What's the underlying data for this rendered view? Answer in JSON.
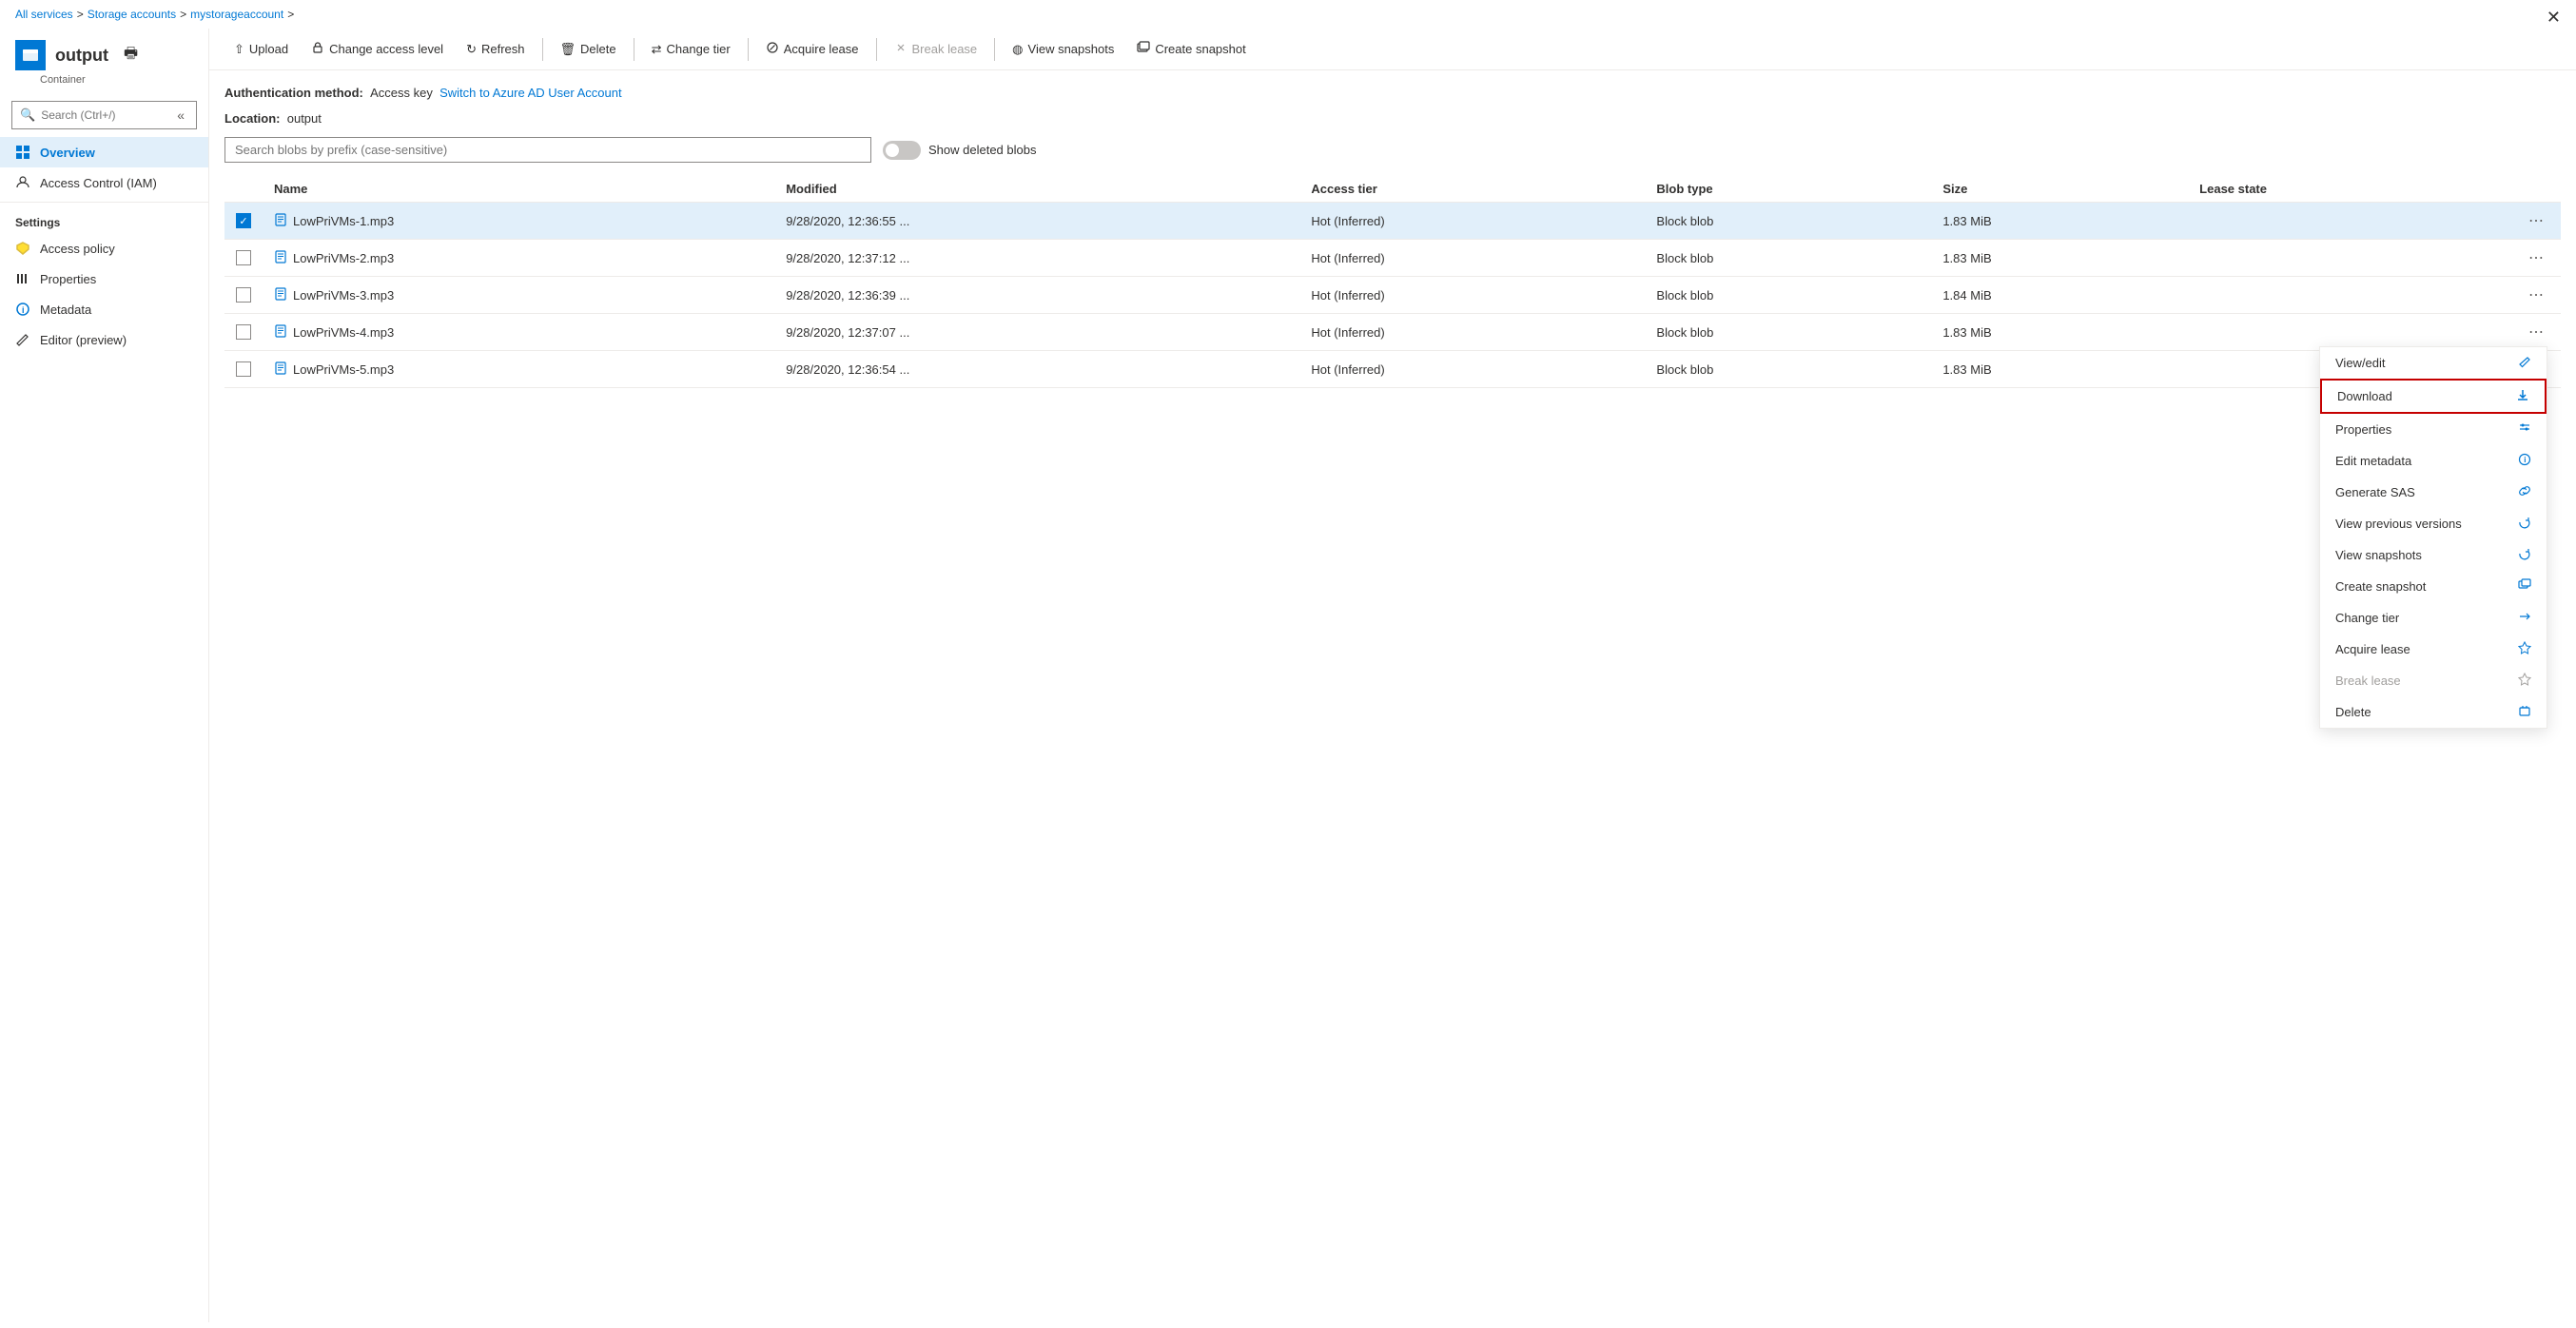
{
  "breadcrumb": {
    "all_services": "All services",
    "storage_accounts": "Storage accounts",
    "storage_account_name": "mystorageaccount"
  },
  "sidebar": {
    "container_name": "output",
    "container_type": "Container",
    "search_placeholder": "Search (Ctrl+/)",
    "nav_items": [
      {
        "id": "overview",
        "label": "Overview",
        "active": true
      },
      {
        "id": "access-control",
        "label": "Access Control (IAM)",
        "active": false
      }
    ],
    "settings_label": "Settings",
    "settings_items": [
      {
        "id": "access-policy",
        "label": "Access policy"
      },
      {
        "id": "properties",
        "label": "Properties"
      },
      {
        "id": "metadata",
        "label": "Metadata"
      },
      {
        "id": "editor",
        "label": "Editor (preview)"
      }
    ]
  },
  "toolbar": {
    "upload_label": "Upload",
    "change_access_label": "Change access level",
    "refresh_label": "Refresh",
    "delete_label": "Delete",
    "change_tier_label": "Change tier",
    "acquire_lease_label": "Acquire lease",
    "break_lease_label": "Break lease",
    "view_snapshots_label": "View snapshots",
    "create_snapshot_label": "Create snapshot"
  },
  "auth": {
    "method_label": "Authentication method:",
    "method_value": "Access key",
    "switch_link": "Switch to Azure AD User Account",
    "location_label": "Location:",
    "location_value": "output"
  },
  "blob_search": {
    "placeholder": "Search blobs by prefix (case-sensitive)",
    "show_deleted_label": "Show deleted blobs"
  },
  "table": {
    "columns": [
      "Name",
      "Modified",
      "Access tier",
      "Blob type",
      "Size",
      "Lease state"
    ],
    "rows": [
      {
        "name": "LowPriVMs-1.mp3",
        "modified": "9/28/2020, 12:36:55 ...",
        "access_tier": "Hot (Inferred)",
        "blob_type": "Block blob",
        "size": "1.83 MiB",
        "selected": true
      },
      {
        "name": "LowPriVMs-2.mp3",
        "modified": "9/28/2020, 12:37:12 ...",
        "access_tier": "Hot (Inferred)",
        "blob_type": "Block blob",
        "size": "1.83 MiB",
        "selected": false
      },
      {
        "name": "LowPriVMs-3.mp3",
        "modified": "9/28/2020, 12:36:39 ...",
        "access_tier": "Hot (Inferred)",
        "blob_type": "Block blob",
        "size": "1.84 MiB",
        "selected": false
      },
      {
        "name": "LowPriVMs-4.mp3",
        "modified": "9/28/2020, 12:37:07 ...",
        "access_tier": "Hot (Inferred)",
        "blob_type": "Block blob",
        "size": "1.83 MiB",
        "selected": false
      },
      {
        "name": "LowPriVMs-5.mp3",
        "modified": "9/28/2020, 12:36:54 ...",
        "access_tier": "Hot (Inferred)",
        "blob_type": "Block blob",
        "size": "1.83 MiB",
        "selected": false
      }
    ]
  },
  "context_menu": {
    "items": [
      {
        "id": "view-edit",
        "label": "View/edit",
        "disabled": false,
        "icon": "edit"
      },
      {
        "id": "download",
        "label": "Download",
        "disabled": false,
        "icon": "download",
        "highlighted": true
      },
      {
        "id": "properties",
        "label": "Properties",
        "disabled": false,
        "icon": "sliders"
      },
      {
        "id": "edit-metadata",
        "label": "Edit metadata",
        "disabled": false,
        "icon": "info"
      },
      {
        "id": "generate-sas",
        "label": "Generate SAS",
        "disabled": false,
        "icon": "link"
      },
      {
        "id": "view-previous-versions",
        "label": "View previous versions",
        "disabled": false,
        "icon": "versions"
      },
      {
        "id": "view-snapshots",
        "label": "View snapshots",
        "disabled": false,
        "icon": "snapshots"
      },
      {
        "id": "create-snapshot",
        "label": "Create snapshot",
        "disabled": false,
        "icon": "create-snap"
      },
      {
        "id": "change-tier",
        "label": "Change tier",
        "disabled": false,
        "icon": "change-tier"
      },
      {
        "id": "acquire-lease",
        "label": "Acquire lease",
        "disabled": false,
        "icon": "acquire"
      },
      {
        "id": "break-lease",
        "label": "Break lease",
        "disabled": true,
        "icon": "break"
      },
      {
        "id": "delete",
        "label": "Delete",
        "disabled": false,
        "icon": "delete"
      }
    ]
  }
}
